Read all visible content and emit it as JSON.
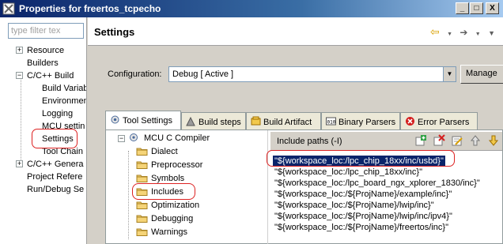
{
  "window": {
    "title": "Properties for freertos_tcpecho",
    "buttons": [
      "_",
      "□",
      "X"
    ]
  },
  "nav": {
    "filter_placeholder": "type filter tex",
    "items": [
      {
        "label": "Resource",
        "expander": "+"
      },
      {
        "label": "Builders",
        "expander": ""
      },
      {
        "label": "C/C++ Build",
        "expander": "−"
      },
      {
        "label": "Build Variab",
        "expander": ""
      },
      {
        "label": "Environmen",
        "expander": ""
      },
      {
        "label": "Logging",
        "expander": ""
      },
      {
        "label": "MCU settin",
        "expander": ""
      },
      {
        "label": "Settings",
        "expander": ""
      },
      {
        "label": "Tool Chain",
        "expander": ""
      },
      {
        "label": "C/C++ Genera",
        "expander": "+"
      },
      {
        "label": "Project Refere",
        "expander": ""
      },
      {
        "label": "Run/Debug Se",
        "expander": ""
      }
    ]
  },
  "page": {
    "title": "Settings",
    "nav_icons": [
      "back-arrow-icon",
      "forward-arrow-icon",
      "menu-arrow-icon"
    ]
  },
  "configuration": {
    "label": "Configuration:",
    "value": "Debug  [ Active ]",
    "manage_label": "Manage"
  },
  "tabs": [
    {
      "label": "Tool Settings",
      "icon": "tool-settings-icon",
      "active": true
    },
    {
      "label": "Build steps",
      "icon": "build-steps-icon",
      "active": false
    },
    {
      "label": "Build Artifact",
      "icon": "build-artifact-icon",
      "active": false
    },
    {
      "label": "Binary Parsers",
      "icon": "binary-parsers-icon",
      "active": false
    },
    {
      "label": "Error Parsers",
      "icon": "error-parsers-icon",
      "active": false
    }
  ],
  "tool_tree": {
    "root": {
      "label": "MCU C Compiler",
      "expander": "−"
    },
    "children": [
      "Dialect",
      "Preprocessor",
      "Symbols",
      "Includes",
      "Optimization",
      "Debugging",
      "Warnings"
    ]
  },
  "include_paths": {
    "title": "Include paths (-I)",
    "tools": [
      "add-icon",
      "delete-icon",
      "edit-icon",
      "move-up-icon",
      "move-down-icon"
    ],
    "items": [
      "\"${workspace_loc:/lpc_chip_18xx/inc/usbd}\"",
      "\"${workspace_loc:/lpc_chip_18xx/inc}\"",
      "\"${workspace_loc:/lpc_board_ngx_xplorer_1830/inc}\"",
      "\"${workspace_loc:/${ProjName}/example/inc}\"",
      "\"${workspace_loc:/${ProjName}/lwip/inc}\"",
      "\"${workspace_loc:/${ProjName}/lwip/inc/ipv4}\"",
      "\"${workspace_loc:/${ProjName}/freertos/inc}\""
    ],
    "selected_index": 0
  },
  "colors": {
    "highlight_ring": "#dd2222",
    "selection": "#0a246a"
  }
}
